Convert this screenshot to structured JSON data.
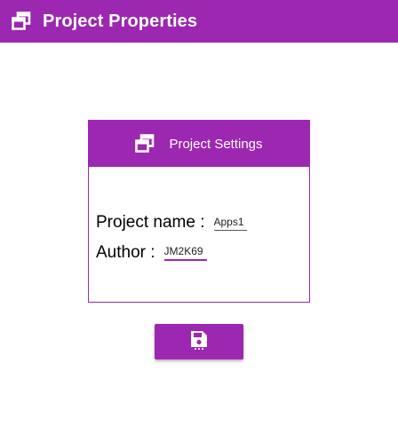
{
  "appbar": {
    "title": "Project Properties",
    "icon": "window-restore-icon"
  },
  "card": {
    "header_label": "Project Settings",
    "header_icon": "window-restore-icon",
    "project_name_label": "Project name :",
    "project_name_value": "Apps1",
    "author_label": "Author :",
    "author_value": "JM2K69"
  },
  "save_button": {
    "icon": "save-icon"
  },
  "colors": {
    "accent": "#9c27b0",
    "background": "#ffffff"
  }
}
